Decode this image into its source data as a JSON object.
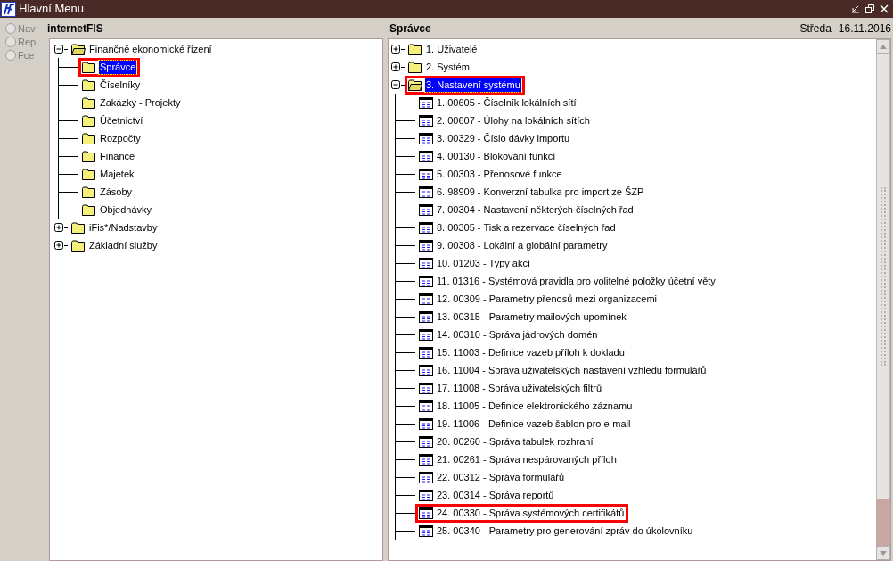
{
  "window": {
    "title": "Hlavní Menu"
  },
  "radio_options": [
    {
      "label": "Nav",
      "selected": false,
      "disabled": true
    },
    {
      "label": "Rep",
      "selected": false,
      "disabled": true
    },
    {
      "label": "Fce",
      "selected": false,
      "disabled": true
    }
  ],
  "left_panel": {
    "title": "internetFIS",
    "tree": [
      {
        "label": "Finančně ekonomické řízení",
        "kind": "folder",
        "expanded": true,
        "selected": false,
        "annotated": false,
        "children": [
          {
            "label": "Správce",
            "kind": "folder",
            "selected": true,
            "annotated": true
          },
          {
            "label": "Číselníky",
            "kind": "folder",
            "selected": false,
            "annotated": false
          },
          {
            "label": "Zakázky - Projekty",
            "kind": "folder",
            "selected": false,
            "annotated": false
          },
          {
            "label": "Účetnictví",
            "kind": "folder",
            "selected": false,
            "annotated": false
          },
          {
            "label": "Rozpočty",
            "kind": "folder",
            "selected": false,
            "annotated": false
          },
          {
            "label": "Finance",
            "kind": "folder",
            "selected": false,
            "annotated": false
          },
          {
            "label": "Majetek",
            "kind": "folder",
            "selected": false,
            "annotated": false
          },
          {
            "label": "Zásoby",
            "kind": "folder",
            "selected": false,
            "annotated": false
          },
          {
            "label": "Objednávky",
            "kind": "folder",
            "selected": false,
            "annotated": false
          }
        ]
      },
      {
        "label": "iFis*/Nadstavby",
        "kind": "folder",
        "expanded": false,
        "selected": false,
        "annotated": false
      },
      {
        "label": "Základní služby",
        "kind": "folder",
        "expanded": false,
        "selected": false,
        "annotated": false
      }
    ]
  },
  "right_panel": {
    "title": "Správce",
    "day": "Středa",
    "date": "16.11.2016",
    "tree": [
      {
        "label": "1.  Uživatelé",
        "kind": "folder",
        "expanded": false,
        "selected": false,
        "annotated": false
      },
      {
        "label": "2.  Systém",
        "kind": "folder",
        "expanded": false,
        "selected": false,
        "annotated": false
      },
      {
        "label": "3.  Nastavení systému",
        "kind": "folder",
        "expanded": true,
        "selected": true,
        "annotated": true,
        "children": [
          {
            "label": "1.  00605 - Číselník lokálních sítí",
            "kind": "form",
            "selected": false,
            "annotated": false
          },
          {
            "label": "2.  00607 - Úlohy na lokálních sítích",
            "kind": "form",
            "selected": false,
            "annotated": false
          },
          {
            "label": "3.  00329 - Číslo dávky importu",
            "kind": "form",
            "selected": false,
            "annotated": false
          },
          {
            "label": "4.  00130 - Blokování funkcí",
            "kind": "form",
            "selected": false,
            "annotated": false
          },
          {
            "label": "5.  00303 - Přenosové funkce",
            "kind": "form",
            "selected": false,
            "annotated": false
          },
          {
            "label": "6.  98909 - Konverzní tabulka pro import ze ŠZP",
            "kind": "form",
            "selected": false,
            "annotated": false
          },
          {
            "label": "7.  00304 - Nastavení některých číselných řad",
            "kind": "form",
            "selected": false,
            "annotated": false
          },
          {
            "label": "8.  00305 - Tisk a rezervace číselných řad",
            "kind": "form",
            "selected": false,
            "annotated": false
          },
          {
            "label": "9.  00308 - Lokální a globální parametry",
            "kind": "form",
            "selected": false,
            "annotated": false
          },
          {
            "label": "10. 01203 - Typy akcí",
            "kind": "form",
            "selected": false,
            "annotated": false
          },
          {
            "label": "11. 01316 - Systémová pravidla pro volitelné položky účetní věty",
            "kind": "form",
            "selected": false,
            "annotated": false
          },
          {
            "label": "12. 00309 - Parametry přenosů mezi organizacemi",
            "kind": "form",
            "selected": false,
            "annotated": false
          },
          {
            "label": "13. 00315 - Parametry mailových upomínek",
            "kind": "form",
            "selected": false,
            "annotated": false
          },
          {
            "label": "14. 00310 - Správa jádrových domén",
            "kind": "form",
            "selected": false,
            "annotated": false
          },
          {
            "label": "15. 11003 - Definice vazeb příloh k dokladu",
            "kind": "form",
            "selected": false,
            "annotated": false
          },
          {
            "label": "16. 11004 - Správa uživatelských nastavení vzhledu formulářů",
            "kind": "form",
            "selected": false,
            "annotated": false
          },
          {
            "label": "17. 11008 - Správa uživatelských filtrů",
            "kind": "form",
            "selected": false,
            "annotated": false
          },
          {
            "label": "18. 11005 - Definice elektronického záznamu",
            "kind": "form",
            "selected": false,
            "annotated": false
          },
          {
            "label": "19. 11006 - Definice vazeb šablon pro e-mail",
            "kind": "form",
            "selected": false,
            "annotated": false
          },
          {
            "label": "20. 00260 - Správa tabulek rozhraní",
            "kind": "form",
            "selected": false,
            "annotated": false
          },
          {
            "label": "21. 00261 - Správa nespárovaných příloh",
            "kind": "form",
            "selected": false,
            "annotated": false
          },
          {
            "label": "22. 00312 - Správa formulářů",
            "kind": "form",
            "selected": false,
            "annotated": false
          },
          {
            "label": "23. 00314 - Správa reportů",
            "kind": "form",
            "selected": false,
            "annotated": false
          },
          {
            "label": "24. 00330 - Správa systémových certifikátů",
            "kind": "form",
            "selected": false,
            "annotated": true
          },
          {
            "label": "25. 00340 - Parametry pro generování zpráv do úkolovníku",
            "kind": "form",
            "selected": false,
            "annotated": false
          }
        ]
      }
    ]
  }
}
